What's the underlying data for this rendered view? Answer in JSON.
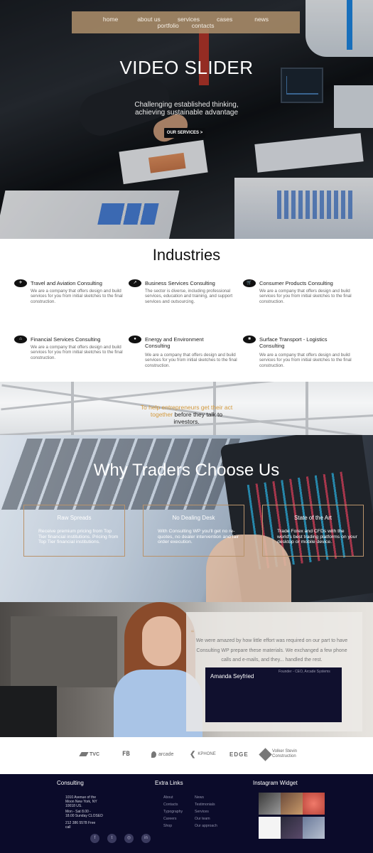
{
  "nav": {
    "home": "home",
    "about": "about us",
    "services": "services",
    "cases": "cases",
    "news": "news",
    "portfolio": "portfolio",
    "contacts": "contacts"
  },
  "hero": {
    "title": "VIDEO SLIDER",
    "subtitle_line1": "Challenging established thinking,",
    "subtitle_line2": "achieving sustainable advantage",
    "button": "OUR SERVICES >"
  },
  "industries": {
    "title": "Industries",
    "items": [
      {
        "icon": "plane-icon",
        "glyph": "✈",
        "name": "Travel and Aviation Consulting",
        "desc": "We are a company that offers design and build services for you from initial sketches to the final construction."
      },
      {
        "icon": "chart-icon",
        "glyph": "↗",
        "name": "Business Services Consulting",
        "desc": "The sector is diverse, including professional services, education and training, and support services and outsourcing."
      },
      {
        "icon": "cart-icon",
        "glyph": "🛒",
        "name": "Consumer Products Consulting",
        "desc": "We are a company that offers design and build services for you from initial sketches to the final construction."
      },
      {
        "icon": "bank-icon",
        "glyph": "⌂",
        "name": "Financial Services Consulting",
        "desc": "We are a company that offers design and build services for you from initial sketches to the final construction."
      },
      {
        "icon": "bulb-icon",
        "glyph": "●",
        "name_line1": "Energy and Environment",
        "name_line2": "Consulting",
        "desc": "We are a company that offers design and build services for you from initial sketches to the final construction."
      },
      {
        "icon": "truck-icon",
        "glyph": "■",
        "name_line1": "Surface Transport - Logistics",
        "name_line2": "Consulting",
        "desc": "We are a company that offers design and build services for you from initial sketches to the final construction."
      }
    ]
  },
  "band": {
    "highlight1": "To help entrepreneurs get their act",
    "highlight2": "together",
    "rest1": " before they talk to",
    "rest2": "investors."
  },
  "traders": {
    "title": "Why Traders Choose Us",
    "boxes": [
      {
        "heading": "Raw Spreads",
        "text": "Receive premium pricing from Top Tier financial institutions. Pricing from Top Tier financial institutions."
      },
      {
        "heading": "No Dealing Desk",
        "text": "With Consulting WP you'll get no re-quotes, no dealer intervention and fair order execution."
      },
      {
        "heading": "State of the Art",
        "text": "Trade Forex and CFDs with the world's best trading platforms on your desktop or mobile device."
      }
    ]
  },
  "testimonial": {
    "quote": "We were amazed by how little effort was required on our part to have Consulting WP prepare these materials. We exchanged a few phone calls and e-mails, and they... handled the rest.",
    "name": "Amanda Seyfried",
    "role": "Founder - CEO, Arcade Systems"
  },
  "logos": [
    "TVC",
    "FB",
    "arcade",
    "KPHONE",
    "EDGE",
    "Volker Stevin Construction"
  ],
  "footer": {
    "col1_title": "Consulting",
    "address": [
      "1010 Avenue of the",
      "Moon New York, NY",
      "10018 US."
    ],
    "hours": [
      "Mon - Sat 8.00 -",
      "18.00 Sunday CLOSED"
    ],
    "phone": [
      "212 386 5578 Free",
      "call"
    ],
    "col2_title": "Extra Links",
    "links_left": [
      "About",
      "Contacts",
      "Typography",
      "Careers",
      "Shop"
    ],
    "links_right": [
      "News",
      "Testimonials",
      "Services",
      "Our team",
      "Our approach"
    ],
    "col3_title": "Instagram Widget",
    "social": [
      "f",
      "t",
      "◎",
      "in"
    ]
  },
  "colors": {
    "nav_bg": "#aa8c69",
    "accent": "#d39a3e",
    "footer_bg": "#0b0b2a",
    "author_box": "#10102e"
  }
}
